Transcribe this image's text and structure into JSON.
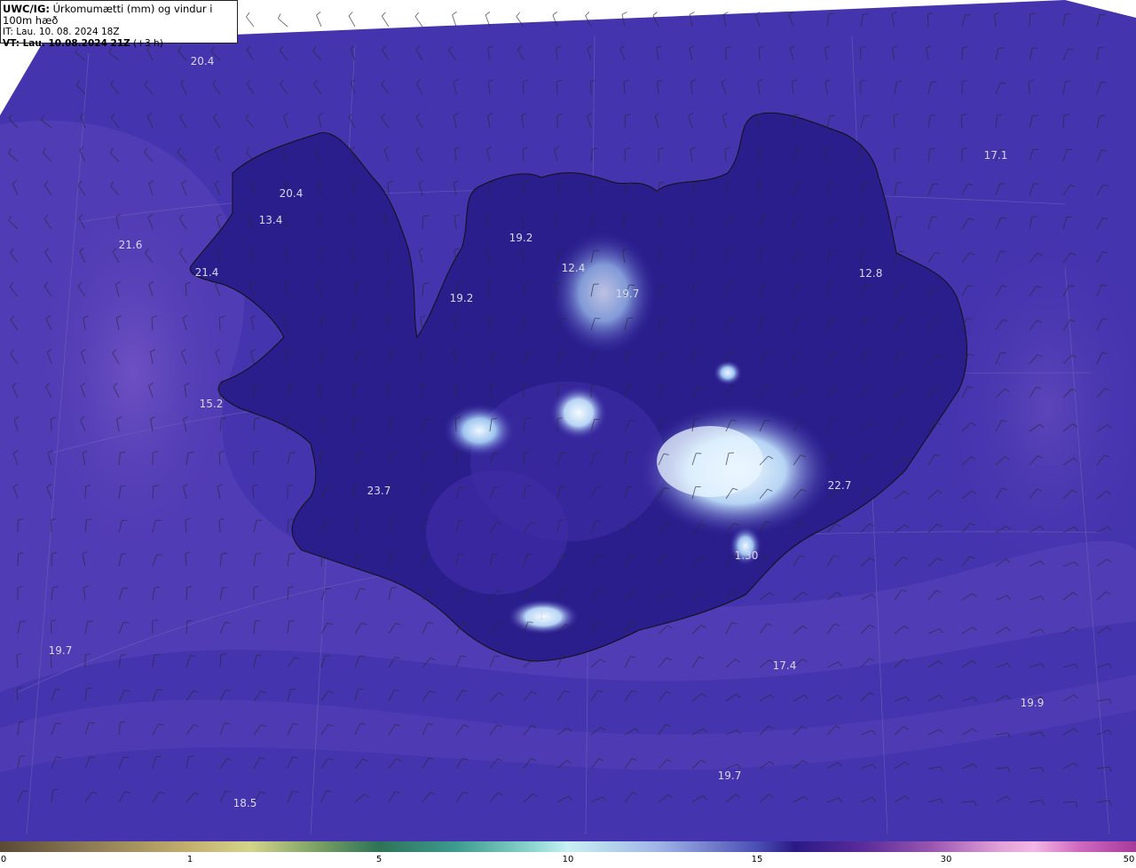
{
  "header": {
    "product": "UWC/IG:",
    "title": "Úrkomumætti (mm) og vindur i 100m hæð",
    "it_line": "IT: Lau. 10. 08. 2024 18Z",
    "vt_prefix": "VT: Lau. 10.08.2024 21Z",
    "vt_suffix": "(+3 h)"
  },
  "map": {
    "background_colors": [
      "#3b2a9a",
      "#6a4cc0",
      "#e8f6ff"
    ],
    "coastline_color": "#1a1a1a",
    "wind_barb_color": "#2a2a2a",
    "value_labels": [
      {
        "text": "20.4"
      },
      {
        "text": "17.1"
      },
      {
        "text": "20.4"
      },
      {
        "text": "13.4"
      },
      {
        "text": "21.6"
      },
      {
        "text": "21.4"
      },
      {
        "text": "19.2"
      },
      {
        "text": "12.4"
      },
      {
        "text": "19.2"
      },
      {
        "text": "19.7"
      },
      {
        "text": "12.8"
      },
      {
        "text": "15.2"
      },
      {
        "text": "23.7"
      },
      {
        "text": "22.7"
      },
      {
        "text": "1.30"
      },
      {
        "text": "1."
      },
      {
        "text": "19.7"
      },
      {
        "text": "17.4"
      },
      {
        "text": "19.9"
      },
      {
        "text": "19.7"
      },
      {
        "text": "18.5"
      }
    ]
  },
  "colorbar": {
    "ticks": [
      "0",
      "1",
      "5",
      "10",
      "15",
      "30",
      "50"
    ]
  }
}
